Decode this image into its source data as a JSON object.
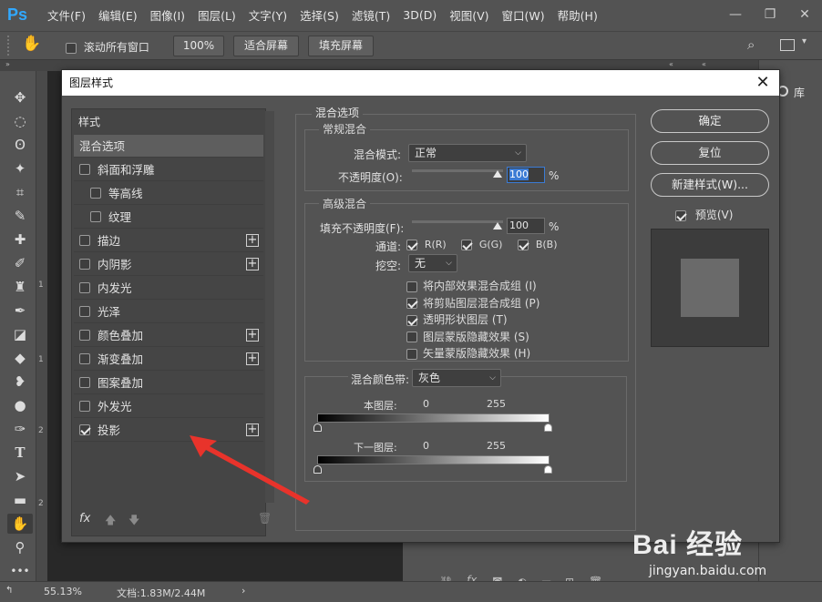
{
  "app": {
    "logo": "Ps"
  },
  "menu": [
    "文件(F)",
    "编辑(E)",
    "图像(I)",
    "图层(L)",
    "文字(Y)",
    "选择(S)",
    "滤镜(T)",
    "3D(D)",
    "视图(V)",
    "窗口(W)",
    "帮助(H)"
  ],
  "options_bar": {
    "scroll_all_label": "滚动所有窗口",
    "zoom_btn": "100%",
    "fit_btn": "适合屏幕",
    "fill_btn": "填充屏幕"
  },
  "ruler_marks": [
    "1",
    "1",
    "2",
    "2"
  ],
  "right_panel": {
    "lib_label": "库"
  },
  "status": {
    "zoom": "55.13%",
    "doc": "文档:1.83M/2.44M"
  },
  "dialog": {
    "title": "图层样式",
    "styles_header": "样式",
    "items": [
      {
        "label": "混合选项",
        "checkbox": false,
        "checked": false,
        "plus": false,
        "selected": true,
        "indent": 0
      },
      {
        "label": "斜面和浮雕",
        "checkbox": true,
        "checked": false,
        "plus": false,
        "selected": false,
        "indent": 0
      },
      {
        "label": "等高线",
        "checkbox": true,
        "checked": false,
        "plus": false,
        "selected": false,
        "indent": 1
      },
      {
        "label": "纹理",
        "checkbox": true,
        "checked": false,
        "plus": false,
        "selected": false,
        "indent": 1
      },
      {
        "label": "描边",
        "checkbox": true,
        "checked": false,
        "plus": true,
        "selected": false,
        "indent": 0
      },
      {
        "label": "内阴影",
        "checkbox": true,
        "checked": false,
        "plus": true,
        "selected": false,
        "indent": 0
      },
      {
        "label": "内发光",
        "checkbox": true,
        "checked": false,
        "plus": false,
        "selected": false,
        "indent": 0
      },
      {
        "label": "光泽",
        "checkbox": true,
        "checked": false,
        "plus": false,
        "selected": false,
        "indent": 0
      },
      {
        "label": "颜色叠加",
        "checkbox": true,
        "checked": false,
        "plus": true,
        "selected": false,
        "indent": 0
      },
      {
        "label": "渐变叠加",
        "checkbox": true,
        "checked": false,
        "plus": true,
        "selected": false,
        "indent": 0
      },
      {
        "label": "图案叠加",
        "checkbox": true,
        "checked": false,
        "plus": false,
        "selected": false,
        "indent": 0
      },
      {
        "label": "外发光",
        "checkbox": true,
        "checked": false,
        "plus": false,
        "selected": false,
        "indent": 0
      },
      {
        "label": "投影",
        "checkbox": true,
        "checked": true,
        "plus": true,
        "selected": false,
        "indent": 0
      }
    ],
    "fx_label": "fx",
    "blend": {
      "section_title": "混合选项",
      "general_title": "常规混合",
      "mode_label": "混合模式:",
      "mode_value": "正常",
      "opacity_label": "不透明度(O):",
      "opacity_value": "100",
      "pct": "%",
      "advanced_title": "高级混合",
      "fill_label": "填充不透明度(F):",
      "fill_value": "100",
      "channels_label": "通道:",
      "ch_r": "R(R)",
      "ch_g": "G(G)",
      "ch_b": "B(B)",
      "knockout_label": "挖空:",
      "knockout_value": "无",
      "opts": [
        {
          "label": "将内部效果混合成组 (I)",
          "checked": false
        },
        {
          "label": "将剪贴图层混合成组 (P)",
          "checked": true
        },
        {
          "label": "透明形状图层 (T)",
          "checked": true
        },
        {
          "label": "图层蒙版隐藏效果 (S)",
          "checked": false
        },
        {
          "label": "矢量蒙版隐藏效果 (H)",
          "checked": false
        }
      ],
      "blendif_label": "混合颜色带:",
      "blendif_value": "灰色",
      "this_layer_label": "本图层:",
      "underlying_label": "下一图层:",
      "v0": "0",
      "v255": "255"
    },
    "buttons": {
      "ok": "确定",
      "reset": "复位",
      "new_style": "新建样式(W)...",
      "preview": "预览(V)"
    }
  },
  "watermark": {
    "brand": "Bai 经验",
    "url": "jingyan.baidu.com"
  }
}
